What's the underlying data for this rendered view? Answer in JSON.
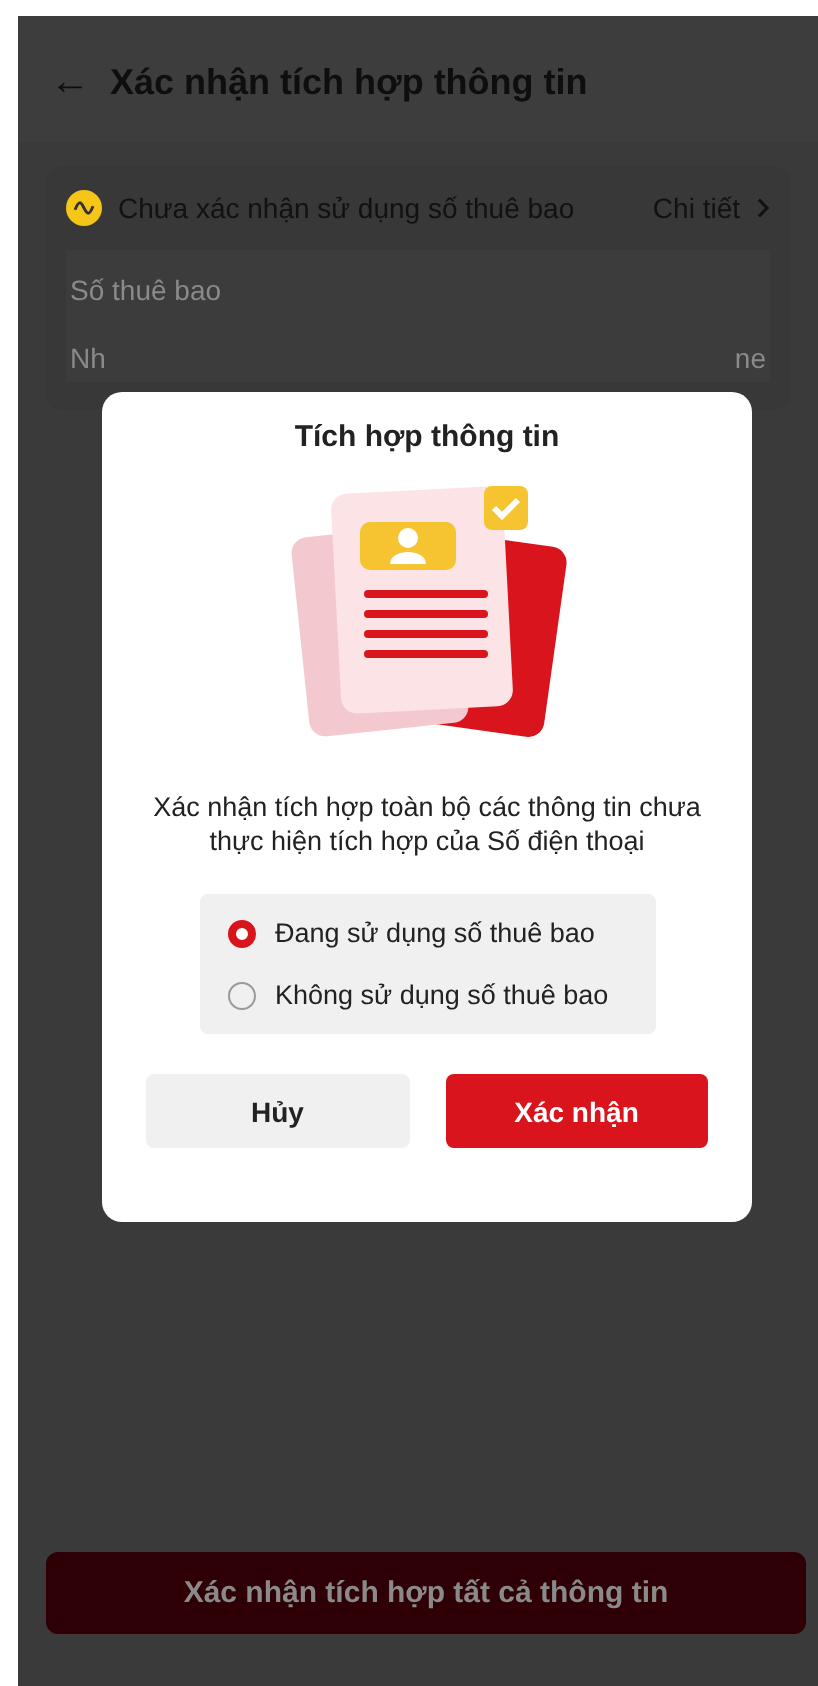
{
  "header": {
    "back_icon": "←",
    "title": "Xác nhận tích hợp thông tin"
  },
  "status_card": {
    "message": "Chưa xác nhận sử dụng số thuê bao",
    "link": "Chi tiết"
  },
  "info_rows": [
    {
      "label": "Số thuê bao"
    },
    {
      "label": "Nh",
      "value": "ne"
    }
  ],
  "bottom_button": {
    "label": "Xác nhận tích hợp tất cả thông tin",
    "disabled": true
  },
  "dialog": {
    "title": "Tích hợp thông tin",
    "message": "Xác nhận tích hợp toàn bộ các thông tin chưa thực hiện tích hợp của Số điện thoại",
    "options": [
      {
        "label": "Đang sử dụng số thuê bao",
        "selected": true
      },
      {
        "label": "Không sử dụng số thuê bao",
        "selected": false
      }
    ],
    "buttons": [
      {
        "label": "Hủy",
        "kind": "secondary"
      },
      {
        "label": "Xác nhận",
        "kind": "primary"
      }
    ]
  }
}
